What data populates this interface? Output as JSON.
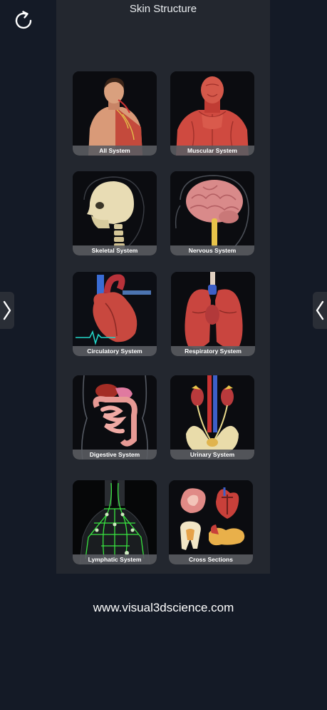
{
  "header": {
    "title": "Skin Structure",
    "refresh_icon": "refresh-icon"
  },
  "nav": {
    "left_icon": "chevron-right-icon",
    "right_icon": "chevron-left-icon"
  },
  "tiles": [
    {
      "label": "All System",
      "icon": "full-body-anatomy"
    },
    {
      "label": "Muscular System",
      "icon": "muscles-anatomy"
    },
    {
      "label": "Skeletal System",
      "icon": "skull-anatomy"
    },
    {
      "label": "Nervous System",
      "icon": "brain-anatomy"
    },
    {
      "label": "Circulatory System",
      "icon": "heart-anatomy"
    },
    {
      "label": "Respiratory System",
      "icon": "lungs-anatomy"
    },
    {
      "label": "Digestive System",
      "icon": "digestive-anatomy"
    },
    {
      "label": "Urinary System",
      "icon": "kidneys-anatomy"
    },
    {
      "label": "Lymphatic System",
      "icon": "lymph-anatomy"
    },
    {
      "label": "Cross Sections",
      "icon": "cross-sections-anatomy"
    }
  ],
  "footer": {
    "website": "www.visual3dscience.com"
  },
  "colors": {
    "background": "#141a26",
    "panel": "#23272f",
    "tile_label": "#5a5c62"
  }
}
